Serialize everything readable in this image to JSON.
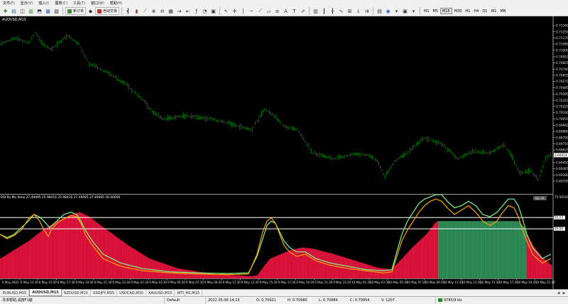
{
  "menu": [
    {
      "label": "文件",
      "hotkey": "(F)"
    },
    {
      "label": "显示",
      "hotkey": "(V)"
    },
    {
      "label": "插入",
      "hotkey": "(I)"
    },
    {
      "label": "图表",
      "hotkey": "(C)"
    },
    {
      "label": "工具",
      "hotkey": "(T)"
    },
    {
      "label": "窗口",
      "hotkey": "(W)"
    },
    {
      "label": "帮助",
      "hotkey": "(H)"
    }
  ],
  "toolbar": {
    "new_order_label": "新订单",
    "auto_trade_label": "自动交易",
    "timeframes": [
      "M1",
      "M5",
      "M15",
      "M30",
      "H1",
      "H4",
      "D1",
      "W1",
      "MN"
    ],
    "active_timeframe": "M15"
  },
  "chart": {
    "symbol_label": "AUDUSD,M15",
    "bar_color": "#00b000",
    "price_axis": [
      "0.71340",
      "0.71255",
      "0.71170",
      "0.71085",
      "0.71000",
      "0.70910",
      "0.70825",
      "0.70740",
      "0.70655",
      "0.70570",
      "0.70485",
      "0.70395",
      "0.70310",
      "0.70225",
      "0.70140",
      "0.70055",
      "0.69965",
      "0.69880",
      "0.69795",
      "0.69710",
      "0.69625",
      "0.69540",
      "0.69450",
      "0.69365",
      "0.69280",
      "0.69195"
    ],
    "current_price": "0.69554"
  },
  "indicator": {
    "label": "RSI Ro Ma Xeeo 27.49495 25.98416 25.98416 27.49495 27.49495 50.00000",
    "badge": "BB 9R",
    "scale_top": "75.90156",
    "level_labels": [
      "55.23",
      "45.00"
    ],
    "level_values": [
      55.23,
      45.0
    ],
    "range": [
      0,
      76
    ]
  },
  "time_axis": [
    "6 May 2022",
    "6 May 13:30",
    "6 May 15:30",
    "6 May 17:30",
    "6 May 19:30",
    "6 May 21:30",
    "6 May 23:30",
    "9 May 01:30",
    "9 May 03:30",
    "9 May 05:30",
    "9 May 07:30",
    "9 May 09:30",
    "9 May 11:30",
    "9 May 13:30",
    "9 May 15:30",
    "9 May 17:30",
    "9 May 19:30",
    "9 May 21:30",
    "9 May 23:30",
    "10 May 01:30",
    "10 May 03:30",
    "10 May 05:30",
    "10 May 07:30",
    "10 May 09:30",
    "10 May 11:30",
    "10 May 13:30",
    "10 May 15:30",
    "10 May 17:30",
    "10 May 19:30",
    "10 May 21:30"
  ],
  "colors": {
    "rsi_line": "#ffa500",
    "signal_line": "#7cfc8a",
    "area_red": "#dc143c",
    "area_green": "#2e8b57",
    "level_line": "#ffffff"
  },
  "tabs": [
    "EURUSD,M15",
    "AUDUSD,M15",
    "NZDUSD,M15",
    "USDJPY,M15",
    "USDCAD,M15",
    "XAUUSD,M15",
    "WTI_M2,M15"
  ],
  "active_tab": "AUDUSD,M15",
  "status": {
    "help": "寻求帮助,请按F1键",
    "profile": "Default",
    "datetime": "2022.05.06 14:15",
    "open": "O: 0.70921",
    "high": "H: 0.70980",
    "low": "L: 0.70884",
    "close": "C: 0.70954",
    "volume": "V: 1207",
    "traffic": "9785/9 kb"
  }
}
